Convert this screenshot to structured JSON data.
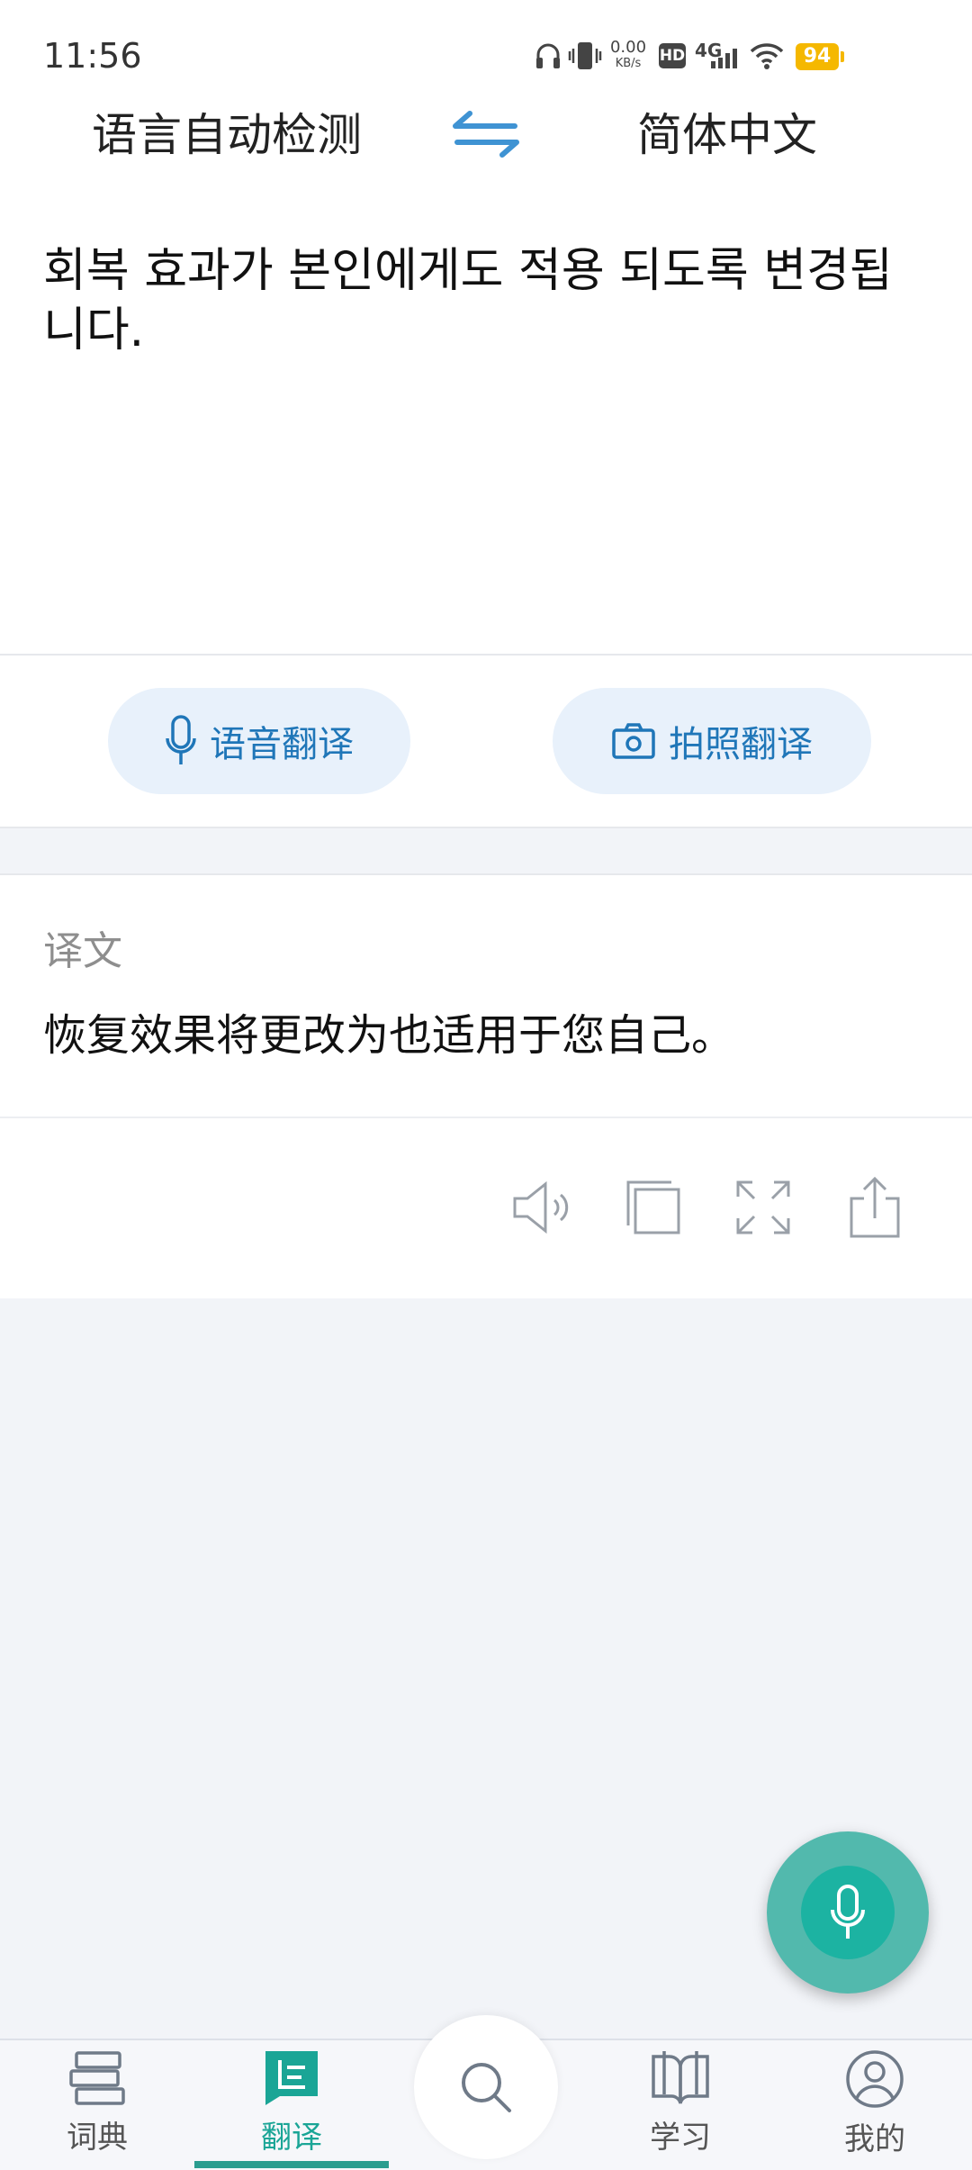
{
  "status_bar": {
    "time": "11:56",
    "speed_value": "0.00",
    "speed_unit": "KB/s",
    "hd_label": "HD",
    "network_label": "4G",
    "battery": "94",
    "icons": [
      "headphones-icon",
      "vibrate-icon",
      "hd-icon",
      "signal-icon",
      "wifi-icon",
      "battery-icon"
    ]
  },
  "language_bar": {
    "source_language": "语言自动检测",
    "target_language": "简体中文",
    "swap_icon": "swap-arrows-icon"
  },
  "input": {
    "text": "회복 효과가 본인에게도 적용 되도록 변경됩니다."
  },
  "actions": {
    "voice_translate": "语音翻译",
    "photo_translate": "拍照翻译"
  },
  "result": {
    "label": "译文",
    "text": "恢复效果将更改为也适用于您自己。",
    "tools": [
      "speaker-icon",
      "copy-icon",
      "fullscreen-icon",
      "share-icon"
    ]
  },
  "bottom_nav": {
    "items": [
      {
        "label": "词典",
        "icon": "dictionary-icon"
      },
      {
        "label": "翻译",
        "icon": "translate-icon",
        "active": true
      },
      {
        "label": "",
        "icon": "search-icon"
      },
      {
        "label": "学习",
        "icon": "book-icon"
      },
      {
        "label": "我的",
        "icon": "profile-icon"
      }
    ]
  },
  "colors": {
    "accent": "#1aa596",
    "fab": "#52b9ad",
    "pill_bg": "#e8f1fb",
    "pill_text": "#1f76b8",
    "battery": "#f5b800"
  }
}
